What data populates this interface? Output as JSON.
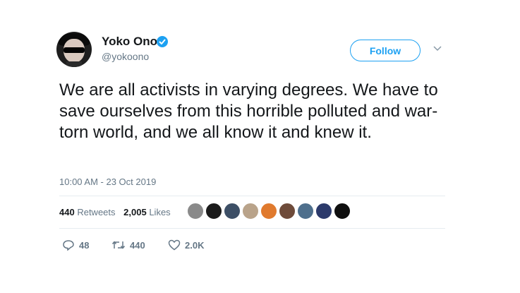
{
  "author": {
    "name": "Yoko Ono",
    "handle": "@yokoono",
    "verified_icon": "verified-badge-icon"
  },
  "header": {
    "follow_label": "Follow",
    "more_icon": "chevron-down-icon"
  },
  "tweet": {
    "text": "We are all activists in varying degrees. We have to save ourselves from this horrible polluted and war-torn world, and we all know it and knew it.",
    "timestamp": "10:00 AM - 23 Oct 2019"
  },
  "stats": {
    "retweets_count": "440",
    "retweets_label": "Retweets",
    "likes_count": "2,005",
    "likes_label": "Likes"
  },
  "likers": [
    {
      "color": "#8a8a8a"
    },
    {
      "color": "#1b1b1b"
    },
    {
      "color": "#3d4f66"
    },
    {
      "color": "#b9a38a"
    },
    {
      "color": "#e07a2e"
    },
    {
      "color": "#6e4b3a"
    },
    {
      "color": "#4e6f8c"
    },
    {
      "color": "#2c3a6b"
    },
    {
      "color": "#0f0f0f"
    }
  ],
  "actions": {
    "reply_count": "48",
    "retweet_count": "440",
    "like_count": "2.0K"
  },
  "colors": {
    "accent": "#1da1f2",
    "secondary_text": "#657786",
    "divider": "#e6ecf0"
  }
}
